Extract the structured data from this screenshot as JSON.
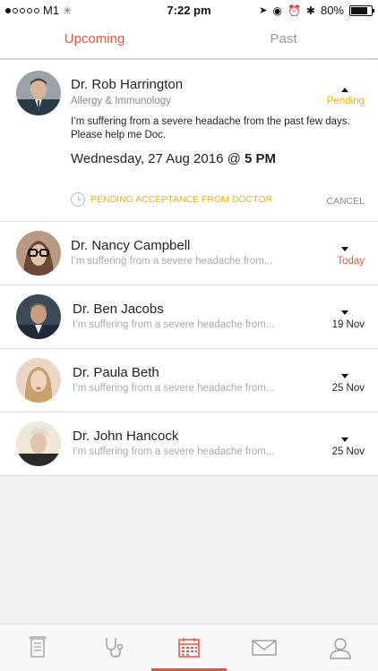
{
  "status_bar": {
    "carrier": "M1",
    "time": "7:22 pm",
    "battery": "80%",
    "battery_level": 0.8
  },
  "tabs": [
    {
      "label": "Upcoming",
      "active": true
    },
    {
      "label": "Past",
      "active": false
    }
  ],
  "expanded": {
    "name": "Dr. Rob Harrington",
    "specialty": "Allergy & Immunology",
    "status": "Pending",
    "message": "I’m suffering from a severe headache from the past few days. Please help me Doc.",
    "date_prefix": "Wednesday, 27 Aug 2016 @ ",
    "date_time": "5 PM",
    "pending_label": "PENDING ACCEPTANCE FROM DOCTOR",
    "cancel_label": "CANCEL"
  },
  "appointments": [
    {
      "name": "Dr. Nancy Campbell",
      "snippet": "I’m suffering from a severe headache from...",
      "date": "Today"
    },
    {
      "name": "Dr. Ben Jacobs",
      "snippet": "I’m suffering from a severe headache from...",
      "date": "19 Nov"
    },
    {
      "name": "Dr. Paula Beth",
      "snippet": "I’m suffering from a severe headache from...",
      "date": "25 Nov"
    },
    {
      "name": "Dr. John Hancock",
      "snippet": "I’m suffering from a severe headache from...",
      "date": "25 Nov"
    }
  ],
  "nav": [
    {
      "icon": "prescription-icon",
      "active": false
    },
    {
      "icon": "stethoscope-icon",
      "active": false
    },
    {
      "icon": "calendar-icon",
      "active": true
    },
    {
      "icon": "mail-icon",
      "active": false
    },
    {
      "icon": "profile-icon",
      "active": false
    }
  ],
  "colors": {
    "accent": "#e8523b",
    "pending": "#f0b400",
    "today": "#e8523b"
  }
}
